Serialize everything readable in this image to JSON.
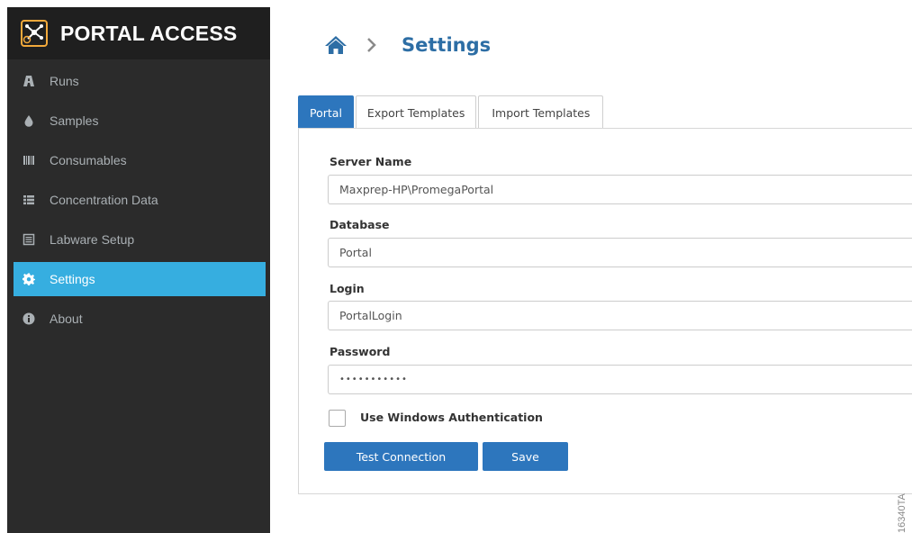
{
  "app": {
    "title": "PORTAL ACCESS",
    "logo_icon": "network-icon",
    "accent_color": "#36aee0",
    "logo_color": "#f2a93b"
  },
  "sidebar": {
    "items": [
      {
        "label": "Runs",
        "icon": "road-icon",
        "active": false
      },
      {
        "label": "Samples",
        "icon": "droplet-icon",
        "active": false
      },
      {
        "label": "Consumables",
        "icon": "barcode-icon",
        "active": false
      },
      {
        "label": "Concentration Data",
        "icon": "list-icon",
        "active": false
      },
      {
        "label": "Labware Setup",
        "icon": "list-alt-icon",
        "active": false
      },
      {
        "label": "Settings",
        "icon": "gear-icon",
        "active": true
      },
      {
        "label": "About",
        "icon": "info-icon",
        "active": false
      }
    ]
  },
  "header": {
    "title": "Settings",
    "title_color": "#2d6ea5"
  },
  "tabs": [
    {
      "label": "Portal",
      "active": true
    },
    {
      "label": "Export Templates",
      "active": false
    },
    {
      "label": "Import Templates",
      "active": false
    }
  ],
  "form": {
    "server_name": {
      "label": "Server Name",
      "value": "Maxprep-HP\\PromegaPortal"
    },
    "database": {
      "label": "Database",
      "value": "Portal"
    },
    "login": {
      "label": "Login",
      "value": "PortalLogin"
    },
    "password": {
      "label": "Password",
      "value": "•••••••••••"
    },
    "windows_auth": {
      "label": "Use Windows Authentication",
      "checked": false
    },
    "test_connection_label": "Test Connection",
    "save_label": "Save",
    "button_color": "#2d76bd"
  },
  "watermark": "16340TA"
}
